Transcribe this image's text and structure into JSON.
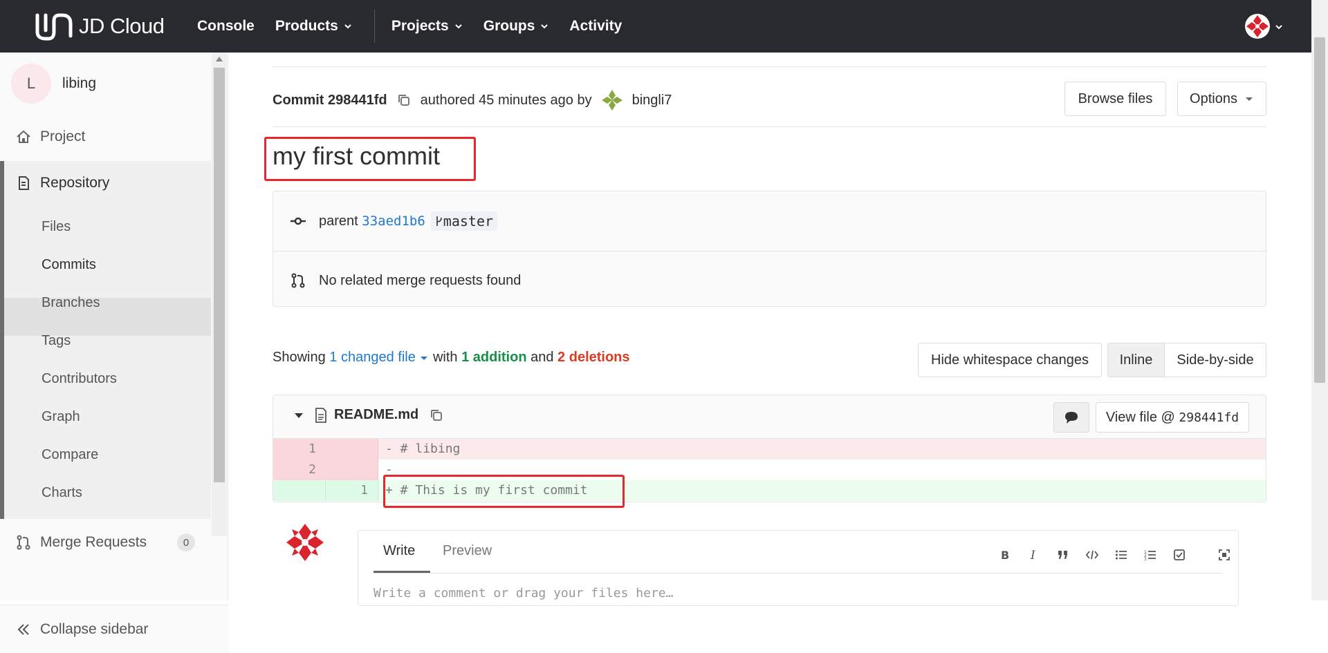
{
  "navbar": {
    "logo_text": "JD Cloud",
    "links": [
      "Console",
      "Products",
      "Projects",
      "Groups",
      "Activity"
    ]
  },
  "sidebar": {
    "project_initial": "L",
    "project_name": "libing",
    "project_label": "Project",
    "repository_label": "Repository",
    "repo_items": [
      "Files",
      "Commits",
      "Branches",
      "Tags",
      "Contributors",
      "Graph",
      "Compare",
      "Charts"
    ],
    "merge_requests_label": "Merge Requests",
    "merge_requests_count": "0",
    "collapse_label": "Collapse sidebar"
  },
  "commit": {
    "label": "Commit",
    "sha": "298441fd",
    "authored": "authored 45 minutes ago by",
    "author": "bingli7",
    "browse_files": "Browse files",
    "options": "Options",
    "title": "my first commit",
    "parent_label": "parent",
    "parent_sha": "33aed1b6",
    "branch": "master",
    "merge_info": "No related merge requests found"
  },
  "diff_summary": {
    "showing": "Showing",
    "changed": "1 changed file",
    "with": "with",
    "additions": "1 addition",
    "and": "and",
    "deletions": "2 deletions",
    "hide_ws": "Hide whitespace changes",
    "inline": "Inline",
    "side_by_side": "Side-by-side"
  },
  "file": {
    "name": "README.md",
    "view_file": "View file @",
    "view_sha": "298441fd",
    "lines": [
      {
        "old": "1",
        "new": "",
        "sign": "-",
        "text": " # libing",
        "type": "del"
      },
      {
        "old": "2",
        "new": "",
        "sign": "-",
        "text": "",
        "type": "del"
      },
      {
        "old": "",
        "new": "1",
        "sign": "+",
        "text": " # This is my first commit",
        "type": "add"
      }
    ]
  },
  "editor": {
    "write": "Write",
    "preview": "Preview",
    "placeholder": "Write a comment or drag your files here…"
  },
  "colors": {
    "navbar": "#292a30",
    "link": "#1f78d1",
    "addition": "#168f48",
    "deletion": "#db3b21",
    "highlight": "#e8262b"
  }
}
